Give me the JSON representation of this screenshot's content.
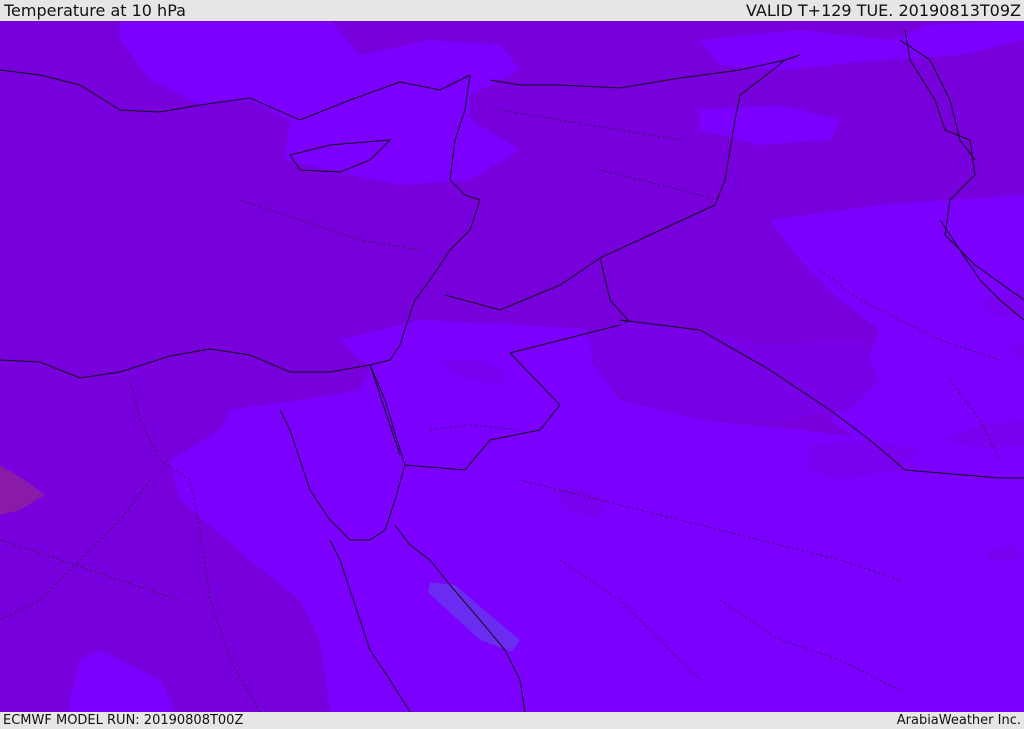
{
  "header": {
    "title": "Temperature at 10 hPa",
    "valid_time": "VALID T+129 TUE. 20190813T09Z"
  },
  "footer": {
    "model_run": "ECMWF MODEL RUN: 20190808T00Z",
    "credit": "ArabiaWeather Inc."
  },
  "colors": {
    "bar_background": "#e6e6e6",
    "field_warm": "#7700dd",
    "field_mid": "#7a00f5",
    "field_cool": "#7b00ff",
    "field_coldest": "#6a2cf0",
    "field_warmest": "#8a1aa8",
    "boundaries": "#111111"
  },
  "map": {
    "region": "Eastern Mediterranean, Levant, Iraq, Egypt and northern Arabia",
    "field": "temperature",
    "pressure_level_hpa": 10
  }
}
